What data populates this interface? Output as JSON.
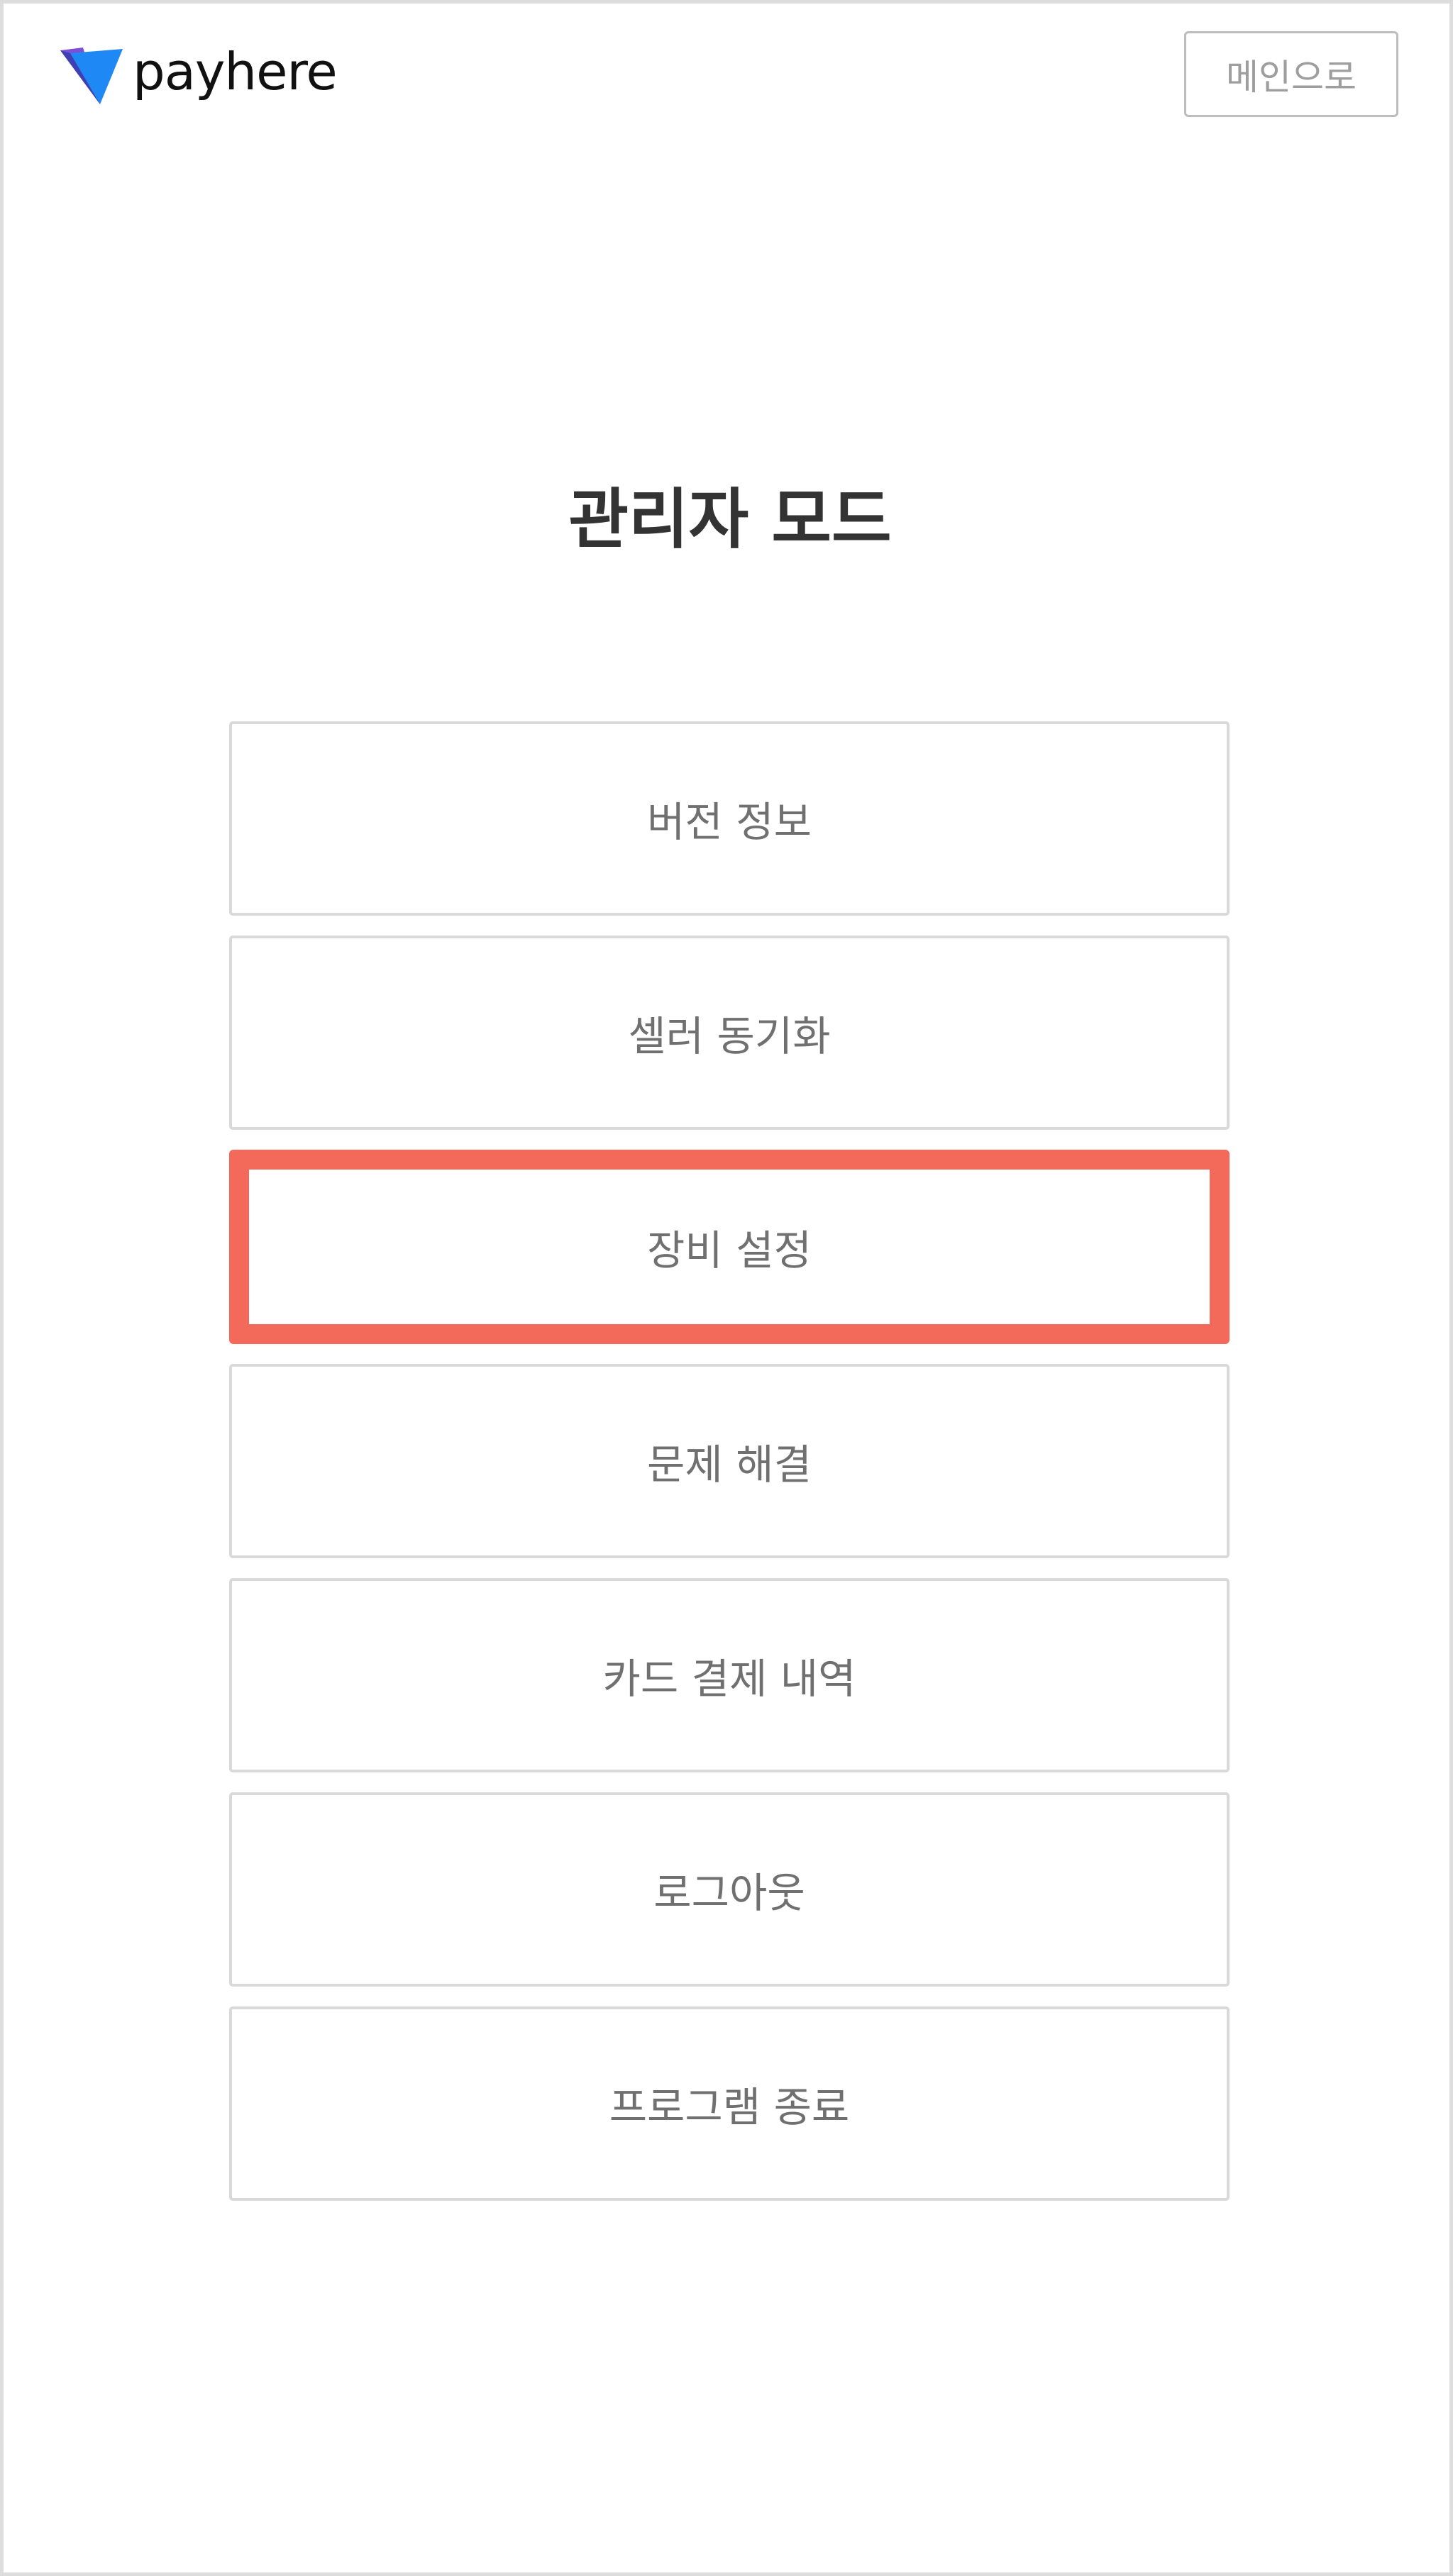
{
  "header": {
    "logo_text": "payhere",
    "back_to_main_label": "메인으로"
  },
  "page": {
    "title": "관리자 모드"
  },
  "menu": {
    "items": [
      {
        "label": "버전 정보"
      },
      {
        "label": "셀러 동기화"
      },
      {
        "label": "장비 설정",
        "highlighted": true
      },
      {
        "label": "문제 해결"
      },
      {
        "label": "카드 결제 내역"
      },
      {
        "label": "로그아웃"
      },
      {
        "label": "프로그램 종료"
      }
    ]
  },
  "colors": {
    "highlight_border": "#f36a5a",
    "logo_blue": "#1e88f5",
    "logo_purple": "#7b4fd6"
  }
}
